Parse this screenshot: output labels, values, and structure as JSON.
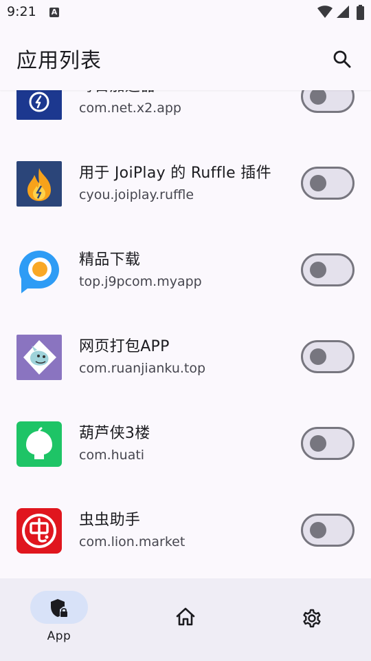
{
  "status_bar": {
    "time": "9:21",
    "notification_icon_letter": "A"
  },
  "app_bar": {
    "title": "应用列表",
    "search_icon": "search-icon"
  },
  "apps": [
    {
      "name": "每日加速器",
      "package": "com.net.x2.app",
      "enabled": false,
      "icon": "timer-icon",
      "icon_color": "#1f3c99"
    },
    {
      "name": "用于 JoiPlay 的 Ruffle 插件",
      "package": "cyou.joiplay.ruffle",
      "enabled": false,
      "icon": "flame-icon",
      "icon_color": "#2b4579"
    },
    {
      "name": "精品下载",
      "package": "top.j9pcom.myapp",
      "enabled": false,
      "icon": "p-logo-icon",
      "icon_color": "#2e9cf5"
    },
    {
      "name": "网页打包APP",
      "package": "com.ruanjianku.top",
      "enabled": false,
      "icon": "mascot-icon",
      "icon_color": "#8a74c0"
    },
    {
      "name": "葫芦侠3楼",
      "package": "com.huati",
      "enabled": false,
      "icon": "gourd-icon",
      "icon_color": "#1ec466"
    },
    {
      "name": "虫虫助手",
      "package": "com.lion.market",
      "enabled": false,
      "icon": "chong-logo-icon",
      "icon_color": "#e0161e"
    }
  ],
  "bottom_nav": {
    "items": [
      {
        "label": "App",
        "icon": "shield-lock-icon",
        "selected": true
      },
      {
        "label": "",
        "icon": "home-icon",
        "selected": false
      },
      {
        "label": "",
        "icon": "gear-icon",
        "selected": false
      }
    ]
  },
  "colors": {
    "background": "#fbf8fd",
    "nav_background": "#efedf5",
    "nav_indicator": "#d8e2f8",
    "toggle_outline": "#77767f",
    "toggle_track": "#e4e1ec"
  }
}
